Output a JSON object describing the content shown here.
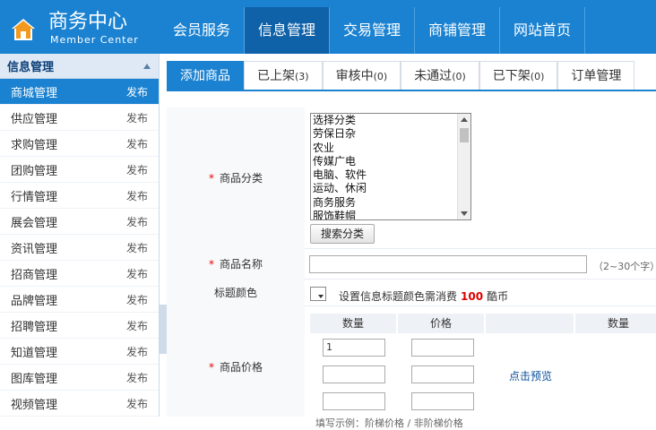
{
  "header": {
    "title": "商务中心",
    "subtitle": "Member Center",
    "nav": [
      {
        "label": "会员服务",
        "active": false
      },
      {
        "label": "信息管理",
        "active": true
      },
      {
        "label": "交易管理",
        "active": false
      },
      {
        "label": "商铺管理",
        "active": false
      },
      {
        "label": "网站首页",
        "active": false
      }
    ]
  },
  "sidebar": {
    "heading": "信息管理",
    "items": [
      {
        "label": "商城管理",
        "action": "发布",
        "active": true
      },
      {
        "label": "供应管理",
        "action": "发布"
      },
      {
        "label": "求购管理",
        "action": "发布"
      },
      {
        "label": "团购管理",
        "action": "发布"
      },
      {
        "label": "行情管理",
        "action": "发布"
      },
      {
        "label": "展会管理",
        "action": "发布"
      },
      {
        "label": "资讯管理",
        "action": "发布"
      },
      {
        "label": "招商管理",
        "action": "发布"
      },
      {
        "label": "品牌管理",
        "action": "发布"
      },
      {
        "label": "招聘管理",
        "action": "发布"
      },
      {
        "label": "知道管理",
        "action": "发布"
      },
      {
        "label": "图库管理",
        "action": "发布"
      },
      {
        "label": "视频管理",
        "action": "发布"
      }
    ]
  },
  "tabs": [
    {
      "label": "添加商品",
      "count": "",
      "active": true
    },
    {
      "label": "已上架",
      "count": "(3)"
    },
    {
      "label": "审核中",
      "count": "(0)"
    },
    {
      "label": "未通过",
      "count": "(0)"
    },
    {
      "label": "已下架",
      "count": "(0)"
    },
    {
      "label": "订单管理",
      "count": ""
    }
  ],
  "form": {
    "category": {
      "label": "商品分类",
      "options": [
        "选择分类",
        "劳保日杂",
        "农业",
        "传媒广电",
        "电脑、软件",
        "运动、休闲",
        "商务服务",
        "服饰鞋帽"
      ],
      "search_button": "搜索分类"
    },
    "name": {
      "label": "商品名称",
      "value": "",
      "hint": "（2~30个字）"
    },
    "title_color": {
      "label": "标题颜色",
      "note_prefix": "设置信息标题颜色需消费",
      "cost": "100",
      "note_suffix": "酷币"
    },
    "price": {
      "label": "商品价格",
      "headers": [
        "数量",
        "价格",
        "",
        "数量"
      ],
      "rows": [
        {
          "qty": "1",
          "price": ""
        },
        {
          "qty": "",
          "price": ""
        },
        {
          "qty": "",
          "price": ""
        }
      ],
      "preview_link": "点击预览",
      "cut_text": "填写示例：阶梯价格 / 非阶梯价格"
    }
  }
}
